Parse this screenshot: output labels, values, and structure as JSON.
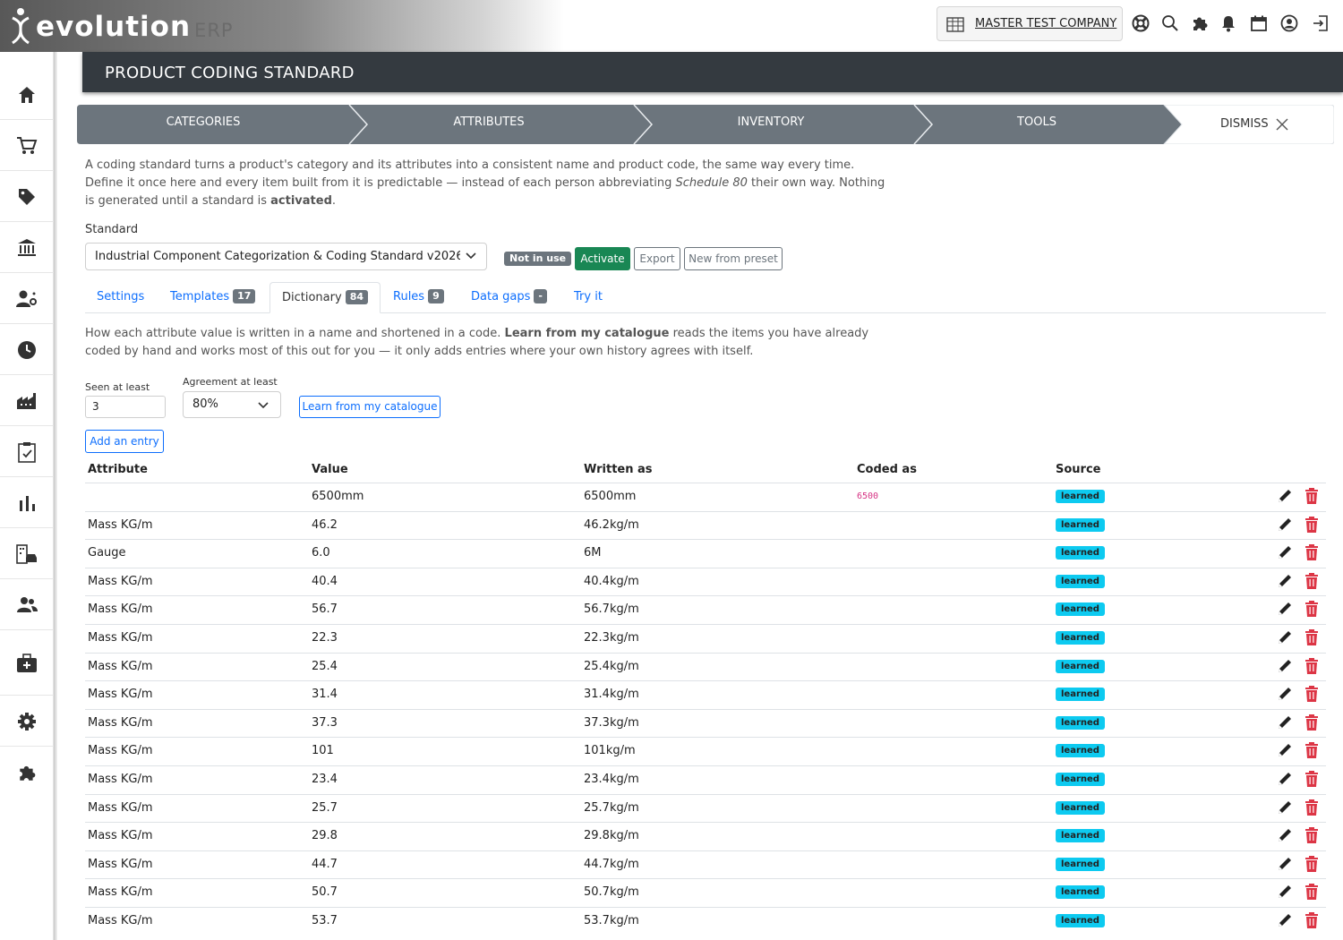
{
  "app": {
    "logo_text": "evolution",
    "logo_suffix": "ERP",
    "company": "MASTER TEST COMPANY"
  },
  "topbar_icons": [
    "company-building-icon",
    "lifebuoy-icon",
    "search-icon",
    "puzzle-icon",
    "bell-icon",
    "calendar-icon",
    "user-circle-icon",
    "logout-icon"
  ],
  "sidebar_icons": [
    "home-icon",
    "cart-icon",
    "tag-icon",
    "bank-icon",
    "user-settings-icon",
    "clock-icon",
    "factory-icon",
    "clipboard-check-icon",
    "bar-chart-icon",
    "building-car-icon",
    "users-icon",
    "medical-kit-icon",
    "gear-icon",
    "puzzle-icon"
  ],
  "page": {
    "title": "PRODUCT CODING STANDARD"
  },
  "steps": {
    "items": [
      "CATEGORIES",
      "ATTRIBUTES",
      "INVENTORY",
      "TOOLS"
    ],
    "dismiss": "DISMISS"
  },
  "intro": {
    "p1": "A coding standard turns a product's category and its attributes into a consistent name and product code, the same way every time.",
    "p2a": "Define it once here and every item built from it is predictable — instead of each person abbreviating ",
    "p2em": "Schedule 80",
    "p2b": " their own way. Nothing",
    "p3a": "is generated until a standard is ",
    "p3b": "activated",
    "p3c": "."
  },
  "standard": {
    "label": "Standard",
    "selected": "Industrial Component Categorization & Coding Standard v2026",
    "status": "Not in use",
    "activate": "Activate",
    "export": "Export",
    "new_from_preset": "New from preset"
  },
  "tabs": [
    {
      "label": "Settings",
      "count": ""
    },
    {
      "label": "Templates",
      "count": "17"
    },
    {
      "label": "Dictionary",
      "count": "84"
    },
    {
      "label": "Rules",
      "count": "9"
    },
    {
      "label": "Data gaps",
      "count": "-"
    },
    {
      "label": "Try it",
      "count": ""
    }
  ],
  "dictionary": {
    "desc1a": "How each attribute value is written in a name and shortened in a code. ",
    "desc1b": "Learn from my catalogue",
    "desc1c": " reads the items you have already",
    "desc2": "coded by hand and works most of this out for you — it only adds entries where your own history agrees with itself.",
    "seen_label": "Seen at least",
    "seen_value": "3",
    "agree_label": "Agreement at least",
    "agree_value": "80%",
    "learn_button": "Learn from my catalogue",
    "add_button": "Add an entry"
  },
  "table": {
    "headers": [
      "Attribute",
      "Value",
      "Written as",
      "Coded as",
      "Source"
    ],
    "rows": [
      [
        "",
        "6500mm",
        "6500mm",
        "6500",
        "learned"
      ],
      [
        "Mass KG/m",
        "46.2",
        "46.2kg/m",
        "",
        "learned"
      ],
      [
        "Gauge",
        "6.0",
        "6M",
        "",
        "learned"
      ],
      [
        "Mass KG/m",
        "40.4",
        "40.4kg/m",
        "",
        "learned"
      ],
      [
        "Mass KG/m",
        "56.7",
        "56.7kg/m",
        "",
        "learned"
      ],
      [
        "Mass KG/m",
        "22.3",
        "22.3kg/m",
        "",
        "learned"
      ],
      [
        "Mass KG/m",
        "25.4",
        "25.4kg/m",
        "",
        "learned"
      ],
      [
        "Mass KG/m",
        "31.4",
        "31.4kg/m",
        "",
        "learned"
      ],
      [
        "Mass KG/m",
        "37.3",
        "37.3kg/m",
        "",
        "learned"
      ],
      [
        "Mass KG/m",
        "101",
        "101kg/m",
        "",
        "learned"
      ],
      [
        "Mass KG/m",
        "23.4",
        "23.4kg/m",
        "",
        "learned"
      ],
      [
        "Mass KG/m",
        "25.7",
        "25.7kg/m",
        "",
        "learned"
      ],
      [
        "Mass KG/m",
        "29.8",
        "29.8kg/m",
        "",
        "learned"
      ],
      [
        "Mass KG/m",
        "44.7",
        "44.7kg/m",
        "",
        "learned"
      ],
      [
        "Mass KG/m",
        "50.7",
        "50.7kg/m",
        "",
        "learned"
      ],
      [
        "Mass KG/m",
        "53.7",
        "53.7kg/m",
        "",
        "learned"
      ]
    ]
  },
  "colors": {
    "header_bg": "#343a40",
    "step_bg": "#6c757d",
    "primary": "#0d6efd",
    "success": "#198754",
    "learned_badge": "#0dcaf0",
    "danger": "#dc3545",
    "code": "#d63384"
  }
}
